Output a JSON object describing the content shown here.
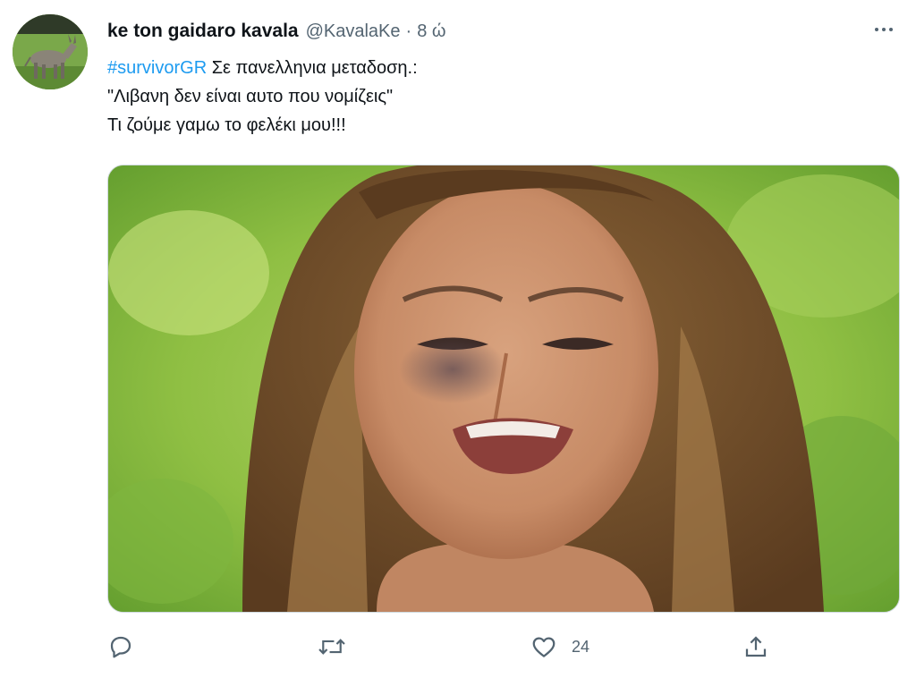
{
  "tweet": {
    "author": {
      "display_name": "ke ton gaidaro kavala",
      "handle": "@KavalaKe",
      "separator": "·",
      "time": "8 ώ",
      "avatar_icon": "donkey-avatar"
    },
    "text": {
      "hashtag": "#survivorGR",
      "line1_rest": " Σε πανελληνια μεταδοση.:",
      "line2": "\"Λιβανη δεν είναι αυτο που νομίζεις\"",
      "line3": "Τι ζούμε γαμω το φελέκι μου!!!"
    },
    "media": {
      "icon": "photo-crying-woman"
    },
    "actions": {
      "reply": {
        "icon": "reply-icon",
        "count": ""
      },
      "retweet": {
        "icon": "retweet-icon",
        "count": ""
      },
      "like": {
        "icon": "heart-icon",
        "count": "24"
      },
      "share": {
        "icon": "share-icon"
      }
    },
    "colors": {
      "accent": "#1d9bf0",
      "secondary_text": "#536471",
      "primary_text": "#0f1419"
    }
  }
}
